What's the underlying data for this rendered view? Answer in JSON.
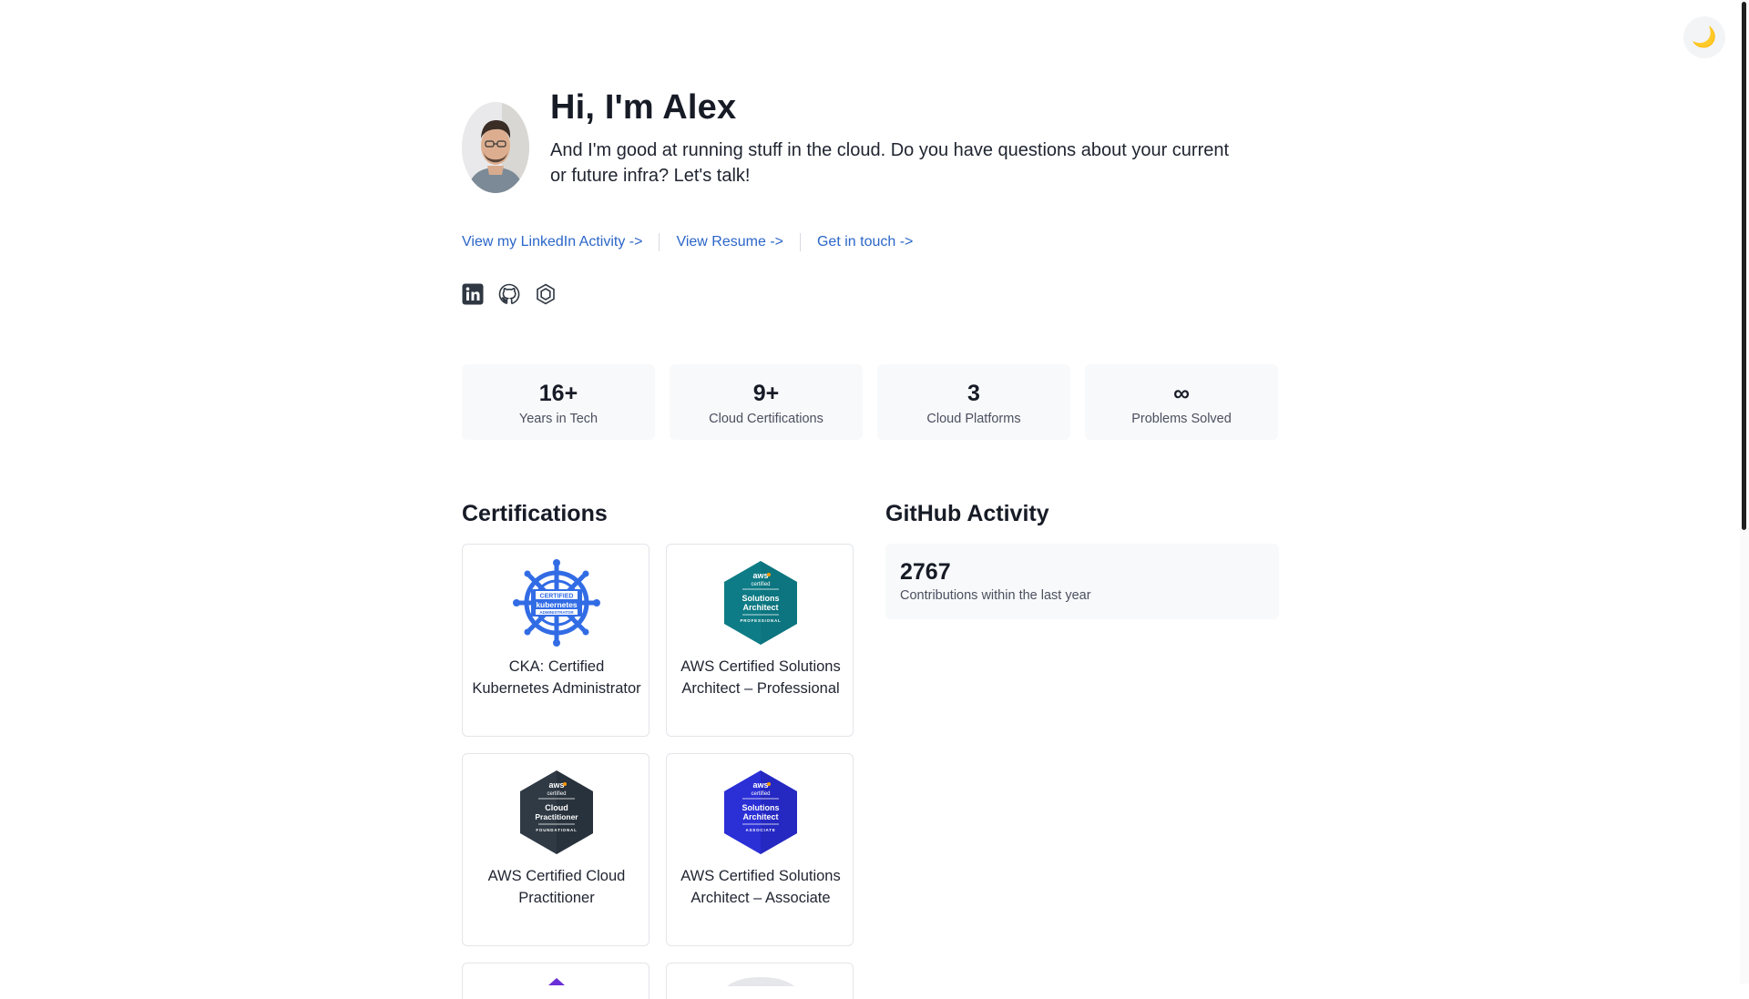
{
  "theme_toggle": {
    "icon": "moon-icon",
    "glyph": "🌙"
  },
  "hero": {
    "title": "Hi, I'm Alex",
    "subtitle": "And I'm good at running stuff in the cloud. Do you have questions about your current or future infra? Let's talk!"
  },
  "links": [
    {
      "label": "View my LinkedIn Activity ->"
    },
    {
      "label": "View Resume ->"
    },
    {
      "label": "Get in touch ->"
    }
  ],
  "socials": [
    {
      "icon": "linkedin-icon"
    },
    {
      "icon": "github-icon"
    },
    {
      "icon": "hexagon-icon"
    }
  ],
  "stats": [
    {
      "value": "16+",
      "label": "Years in Tech"
    },
    {
      "value": "9+",
      "label": "Cloud Certifications"
    },
    {
      "value": "3",
      "label": "Cloud Platforms"
    },
    {
      "value": "∞",
      "label": "Problems Solved"
    }
  ],
  "certifications": {
    "title": "Certifications",
    "items": [
      {
        "name": "CKA: Certified Kubernetes Administrator",
        "badge_text": [
          "CERTIFIED",
          "kubernetes",
          "ADMINISTRATOR"
        ],
        "badge_color": "#326ce5"
      },
      {
        "name": "AWS Certified Solutions Architect – Professional",
        "badge_text": [
          "aws",
          "certified",
          "Solutions",
          "Architect",
          "PROFESSIONAL"
        ],
        "badge_color": "#0e7c86"
      },
      {
        "name": "AWS Certified Cloud Practitioner",
        "badge_text": [
          "aws",
          "certified",
          "Cloud",
          "Practitioner",
          "FOUNDATIONAL"
        ],
        "badge_color": "#2f3a45"
      },
      {
        "name": "AWS Certified Solutions Architect – Associate",
        "badge_text": [
          "aws",
          "certified",
          "Solutions",
          "Architect",
          "ASSOCIATE"
        ],
        "badge_color": "#2b2fd6"
      }
    ]
  },
  "github": {
    "title": "GitHub Activity",
    "count": "2767",
    "label": "Contributions within the last year"
  },
  "colors": {
    "link": "#2b66c8",
    "card_bg": "#f8f9fa",
    "text": "#161b26"
  }
}
